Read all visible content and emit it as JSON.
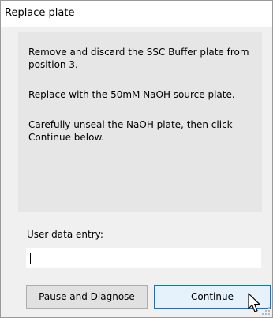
{
  "window": {
    "title": "Replace plate"
  },
  "message": {
    "line1": "Remove and discard the SSC Buffer plate from position 3.",
    "line2": "Replace with the 50mM NaOH source plate.",
    "line3": "Carefully unseal the NaOH plate, then click Continue below."
  },
  "entry": {
    "label": "User data entry:",
    "value": ""
  },
  "buttons": {
    "pause_mnemonic": "P",
    "pause_rest": "ause and Diagnose",
    "continue_mnemonic": "C",
    "continue_rest": "ontinue"
  },
  "colors": {
    "dialog_bg": "#f0f0f0",
    "panel_bg": "#e6e6e6",
    "default_button_border": "#0078d7",
    "default_button_bg": "#e5f1fb"
  },
  "icons": {
    "cursor": "arrow-cursor-icon",
    "grip": "resize-grip-icon"
  }
}
